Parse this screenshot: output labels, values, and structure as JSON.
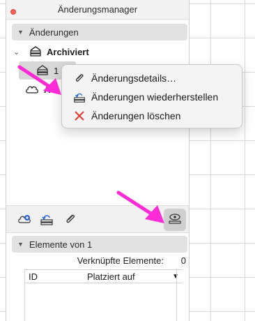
{
  "window": {
    "title": "Änderungsmanager"
  },
  "sections": {
    "changes": {
      "label": "Änderungen"
    },
    "elements": {
      "label": "Elemente von 1"
    }
  },
  "tree": {
    "archived": {
      "label": "Archiviert"
    },
    "item1": {
      "label": "1"
    },
    "item2": {
      "label": "A"
    }
  },
  "context_menu": {
    "items": [
      {
        "label": "Änderungsdetails…",
        "icon": "paperclip-icon"
      },
      {
        "label": "Änderungen wiederherstellen",
        "icon": "restore-icon"
      },
      {
        "label": "Änderungen löschen",
        "icon": "delete-x-icon"
      }
    ]
  },
  "linked": {
    "label": "Verknüpfte Elemente:",
    "count": "0"
  },
  "table": {
    "col_id": "ID",
    "col_placed": "Platziert auf",
    "sort_caret": "▼"
  },
  "colors": {
    "annotation": "#ff2bd6",
    "delete": "#e23b2e",
    "accent": "#2a64d6"
  }
}
